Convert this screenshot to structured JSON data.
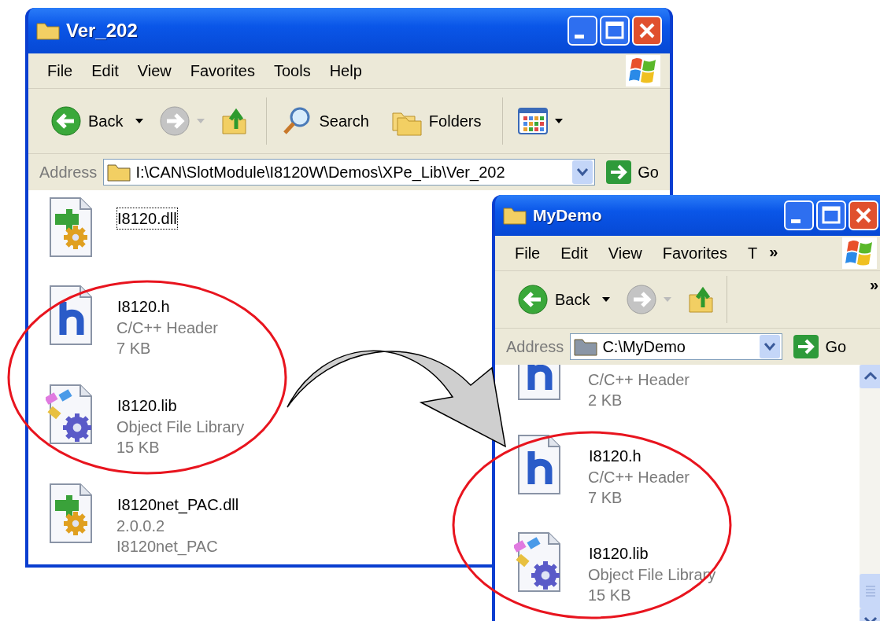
{
  "windows": [
    {
      "title": "Ver_202",
      "menu": [
        "File",
        "Edit",
        "View",
        "Favorites",
        "Tools",
        "Help"
      ],
      "toolbar": [
        {
          "kind": "back",
          "label": "Back",
          "disabled": false
        },
        {
          "kind": "forward",
          "disabled": true
        },
        {
          "kind": "up"
        },
        {
          "kind": "search",
          "label": "Search"
        },
        {
          "kind": "folders",
          "label": "Folders"
        },
        {
          "kind": "views"
        }
      ],
      "address": {
        "label": "Address",
        "value": "I:\\CAN\\SlotModule\\I8120W\\Demos\\XPe_Lib\\Ver_202",
        "go": "Go"
      },
      "files": [
        {
          "kind": "dll",
          "name": "I8120.dll",
          "focused": true
        },
        {
          "kind": "header",
          "name": "I8120.h",
          "focused": false,
          "details": [
            "C/C++ Header",
            "7 KB"
          ]
        },
        {
          "kind": "library",
          "name": "I8120.lib",
          "focused": false,
          "details": [
            "Object File Library",
            "15 KB"
          ]
        },
        {
          "kind": "dll",
          "name": "I8120net_PAC.dll",
          "focused": false,
          "details": [
            "2.0.0.2",
            "I8120net_PAC"
          ]
        }
      ]
    },
    {
      "title": "MyDemo",
      "menu": [
        "File",
        "Edit",
        "View",
        "Favorites",
        "T"
      ],
      "menu_overflow": "»",
      "toolbar": [
        {
          "kind": "back",
          "label": "Back",
          "disabled": false
        },
        {
          "kind": "forward",
          "disabled": true
        },
        {
          "kind": "up"
        }
      ],
      "toolbar_overflow": "»",
      "address": {
        "label": "Address",
        "value": "C:\\MyDemo",
        "go": "Go"
      },
      "files": [
        {
          "kind": "header",
          "focused": false,
          "details": [
            "C/C++ Header",
            "2 KB"
          ]
        },
        {
          "kind": "header",
          "name": "I8120.h",
          "focused": false,
          "details": [
            "C/C++ Header",
            "7 KB"
          ]
        },
        {
          "kind": "library",
          "name": "I8120.lib",
          "focused": false,
          "details": [
            "Object File Library",
            "15 KB"
          ]
        }
      ]
    }
  ]
}
